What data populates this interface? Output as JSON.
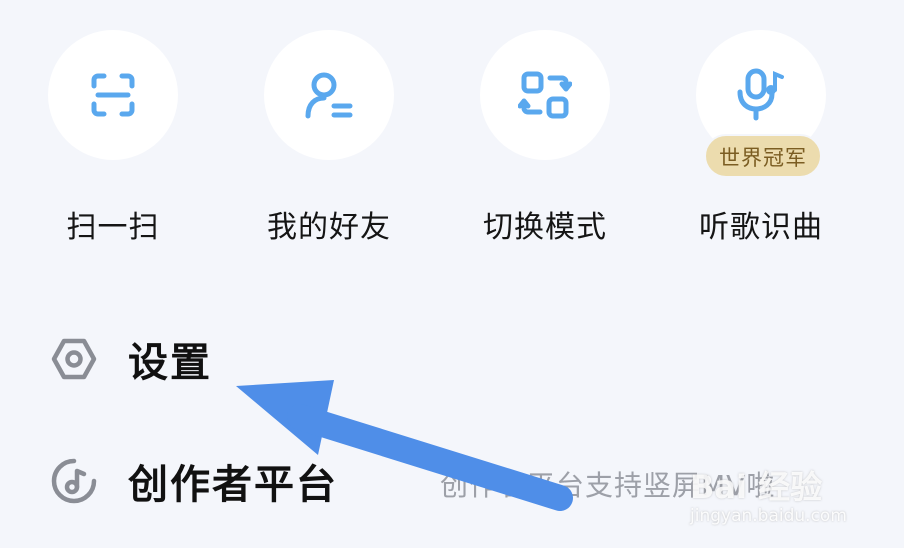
{
  "quick_actions": [
    {
      "label": "扫一扫",
      "icon": "scan-icon"
    },
    {
      "label": "我的好友",
      "icon": "friends-icon"
    },
    {
      "label": "切换模式",
      "icon": "switch-mode-icon"
    },
    {
      "label": "听歌识曲",
      "icon": "song-recognition-icon",
      "badge": "世界冠军"
    }
  ],
  "menu": {
    "settings": {
      "label": "设置",
      "icon": "settings-hexagon-icon"
    },
    "creator": {
      "label": "创作者平台",
      "icon": "creator-platform-icon",
      "subtitle": "创作者平台支持竖屏MV啦"
    }
  },
  "annotation": {
    "arrow_color": "#4f8ee8"
  },
  "watermark": {
    "logo": "Bai 经验",
    "url": "jingyan.baidu.com"
  },
  "colors": {
    "accent": "#5aa8ee",
    "badge_bg": "#ecdcae",
    "background": "#f4f6fb"
  }
}
